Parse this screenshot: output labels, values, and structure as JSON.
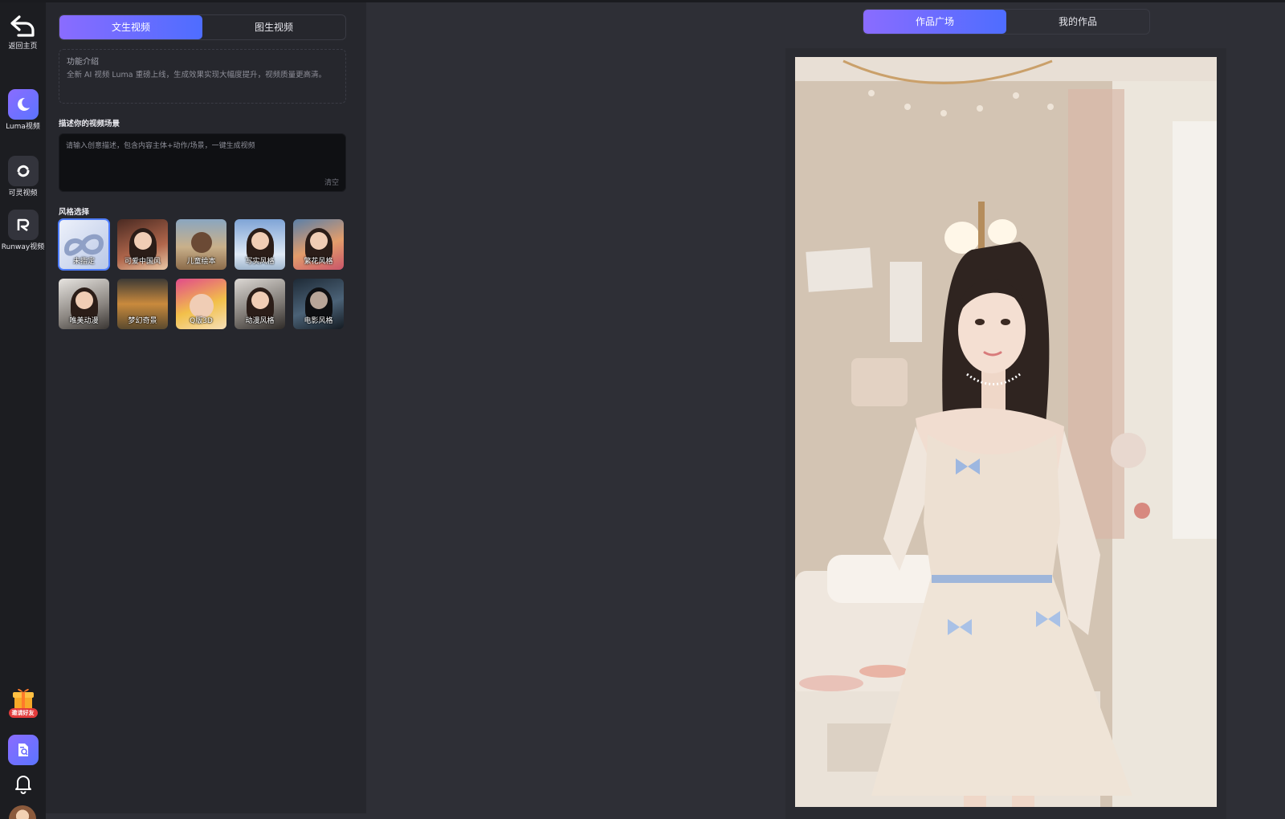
{
  "rail": {
    "home_label": "返回主页",
    "items": [
      {
        "label": "Luma视频",
        "icon": "luma-icon",
        "active": true
      },
      {
        "label": "可灵视频",
        "icon": "kling-icon",
        "active": false
      },
      {
        "label": "Runway视频",
        "icon": "runway-icon",
        "active": false
      }
    ],
    "gift_label": "邀请好友"
  },
  "panel": {
    "mode_tabs": [
      "文生视频",
      "图生视频"
    ],
    "intro_title": "功能介绍",
    "intro_body": "全新 AI 视频 Luma 重磅上线，生成效果实现大幅度提升，视频质量更高清。",
    "prompt_label": "描述你的视频场景",
    "prompt_placeholder": "请输入创意描述，包含内容主体+动作/场景，一键生成视频",
    "clear_label": "清空",
    "style_label": "风格选择",
    "styles": [
      {
        "name": "未指定",
        "selected": true
      },
      {
        "name": "可爱中国风",
        "selected": false
      },
      {
        "name": "儿童绘本",
        "selected": false
      },
      {
        "name": "写实风格",
        "selected": false
      },
      {
        "name": "繁花风格",
        "selected": false
      },
      {
        "name": "唯美动漫",
        "selected": false
      },
      {
        "name": "梦幻奇景",
        "selected": false
      },
      {
        "name": "Q版3D",
        "selected": false
      },
      {
        "name": "动漫风格",
        "selected": false
      },
      {
        "name": "电影风格",
        "selected": false
      }
    ]
  },
  "gallery": {
    "tabs": [
      "作品广场",
      "我的作品"
    ]
  },
  "colors": {
    "accent_start": "#8a6cff",
    "accent_end": "#4e6dff",
    "selected_outline": "#4e7dff",
    "badge_red": "#e23b3b"
  }
}
